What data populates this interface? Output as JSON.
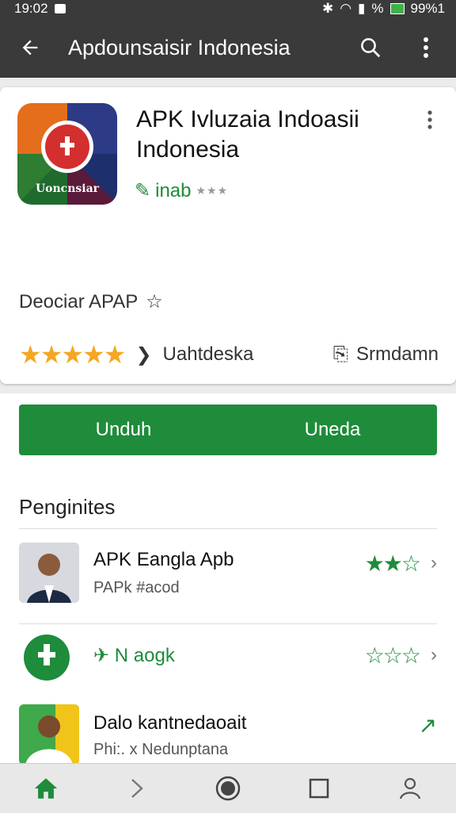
{
  "status_bar": {
    "time": "19:02",
    "right_text": "% ",
    "battery_text": "99%1"
  },
  "app_bar": {
    "title": "Apdounsaisir Indonesia",
    "back_icon": "arrow-left-icon",
    "search_icon": "search-icon",
    "menu_icon": "more-vert-icon"
  },
  "app": {
    "title_line1": "APK Ivluzaia Indoasii",
    "title_line2": "Indonesia",
    "icon_label": "Uoncnsiar",
    "rating_label": "inab",
    "deco_text": "Deociar APAP",
    "stars": "★★★★★",
    "developer": "Uahtdeska",
    "size_label": "Srmdamn"
  },
  "buttons": {
    "install_left": "Unduh",
    "install_right": "Uneda"
  },
  "list": {
    "section_title": "Penginites",
    "items": [
      {
        "title": "APK Eangla Apb",
        "sub": "PAPk #acod",
        "stars": "★★☆"
      },
      {
        "title": "N aogk",
        "sub": "",
        "stars": "☆☆☆"
      },
      {
        "title": "Dalo kantnedaoait",
        "sub": "Phi:. x Nedunptana",
        "stars": ""
      }
    ]
  },
  "bottom_nav": {
    "items": [
      "home-icon",
      "forward-icon",
      "circle-icon",
      "square-icon",
      "account-icon"
    ]
  },
  "colors": {
    "accent": "#1e8c3a",
    "bar": "#3a3a3a",
    "star": "#f5a623"
  }
}
